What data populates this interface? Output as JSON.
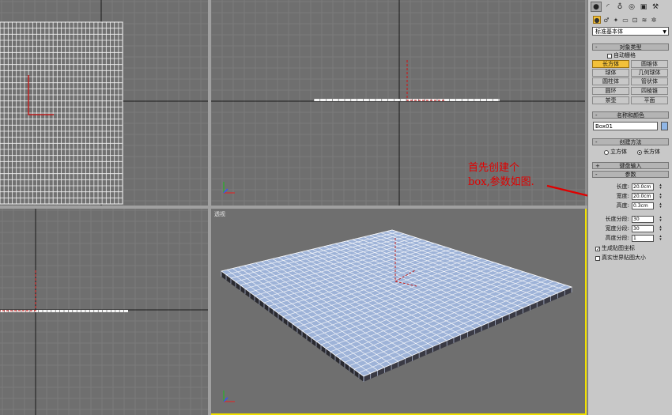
{
  "viewports": {
    "top": {
      "label": ""
    },
    "front": {
      "label": ""
    },
    "left": {
      "label": ""
    },
    "perspective": {
      "label": "透视"
    }
  },
  "annotation": {
    "text": "首先创建个\nbox,参数如图."
  },
  "panel": {
    "tabs": [
      "create-tab",
      "modify-tab",
      "hierarchy-tab",
      "motion-tab",
      "display-tab",
      "utilities-tab"
    ],
    "category_icons": [
      "geometry-icon",
      "shapes-icon",
      "lights-icon",
      "cameras-icon",
      "helpers-icon",
      "spacewarps-icon",
      "systems-icon"
    ],
    "dropdown": "标准基本体",
    "object_type": {
      "title": "对象类型",
      "autogrid": "自动栅格",
      "buttons": [
        "长方体",
        "圆锥体",
        "球体",
        "几何球体",
        "圆柱体",
        "管状体",
        "圆环",
        "四棱锥",
        "茶壶",
        "平面"
      ]
    },
    "name_color": {
      "title": "名称和颜色",
      "name": "Box01",
      "color": "#8fb6e6"
    },
    "creation_method": {
      "title": "创建方法",
      "cube": "立方体",
      "box": "长方体"
    },
    "keyboard_entry": {
      "title": "键盘输入"
    },
    "parameters": {
      "title": "参数",
      "length_label": "长度:",
      "length": "20.0cm",
      "width_label": "宽度:",
      "width": "20.0cm",
      "height_label": "高度:",
      "height": "0.3cm",
      "length_segs_label": "长度分段:",
      "length_segs": "30",
      "width_segs_label": "宽度分段:",
      "width_segs": "30",
      "height_segs_label": "高度分段:",
      "height_segs": "1",
      "gen_mapping": "生成贴图坐标",
      "real_world": "真实世界贴图大小"
    }
  },
  "colors": {
    "selection_yellow": "#f0e000",
    "active_button": "#f3c13a",
    "axis_red": "#c02020",
    "annotation_red": "#e00000"
  }
}
